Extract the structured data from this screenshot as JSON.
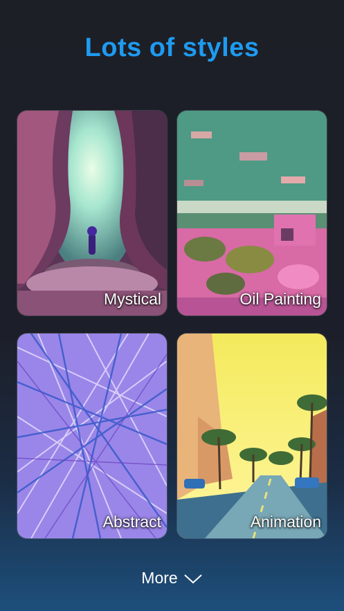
{
  "header": {
    "title": "Lots of styles"
  },
  "styles": [
    {
      "label": "Mystical",
      "art": "cave-figure"
    },
    {
      "label": "Oil Painting",
      "art": "impressionist-landscape"
    },
    {
      "label": "Abstract",
      "art": "blue-purple-lines"
    },
    {
      "label": "Animation",
      "art": "palm-street-sunset"
    }
  ],
  "footer": {
    "more_label": "More",
    "icon": "chevron-down-icon"
  },
  "colors": {
    "title": "#1e9bf0",
    "background_top": "#1d1f27",
    "background_bottom": "#1d4f7c"
  }
}
